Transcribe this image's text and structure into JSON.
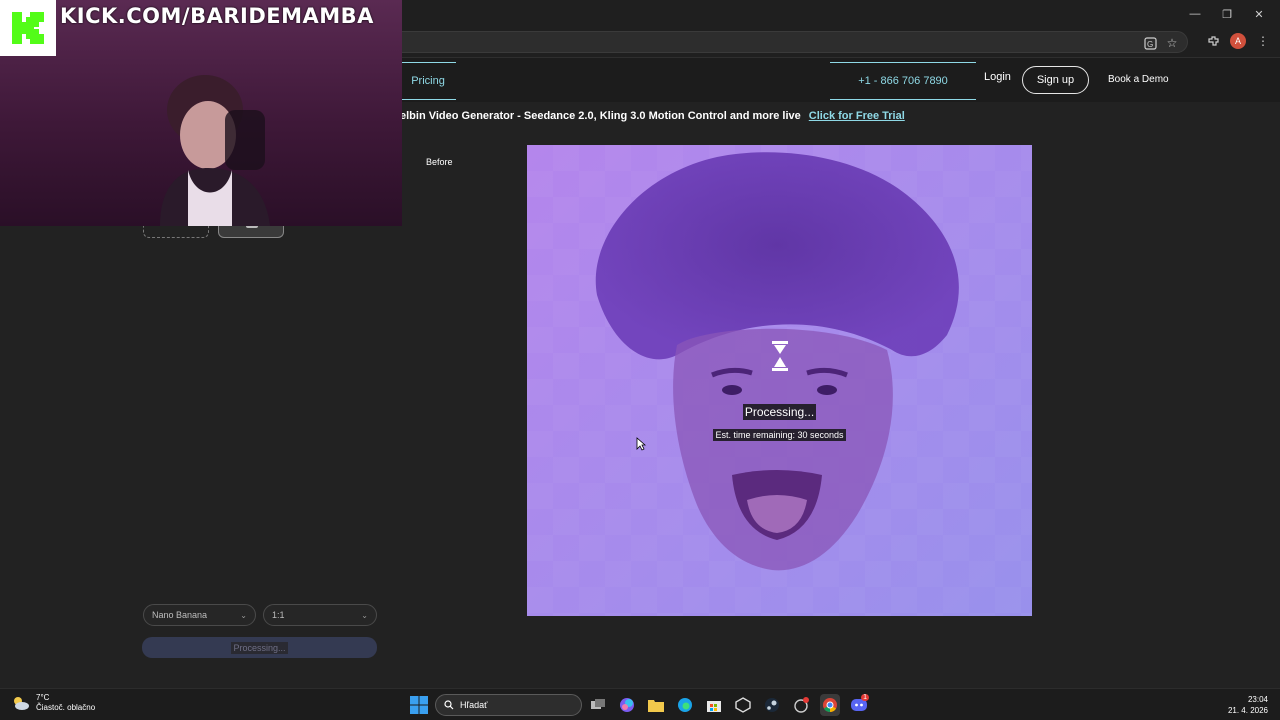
{
  "browser": {
    "window_controls": [
      "—",
      "❐",
      "✕"
    ],
    "profile_initial": "A"
  },
  "nav": {
    "pricing": "Pricing",
    "phone": "+1 - 866 706 7890",
    "login": "Login",
    "signup": "Sign up",
    "demo": "Book a Demo"
  },
  "banner": {
    "text": "elbin Video Generator - Seedance 2.0, Kling 3.0 Motion Control and more live",
    "link": "Click for Free Trial"
  },
  "editor": {
    "before_label": "Before",
    "model_select": "Nano Banana",
    "ratio_select": "1:1",
    "generate_button": "Processing..."
  },
  "preview": {
    "status": "Processing...",
    "eta": "Est. time remaining: 30 seconds"
  },
  "stream_overlay": {
    "url": "KICK.COM/BARIDEMAMBA"
  },
  "taskbar": {
    "weather_temp": "7°C",
    "weather_desc": "Čiastoč. oblačno",
    "search_placeholder": "Hľadať",
    "time": "23:04",
    "date": "21. 4. 2026",
    "discord_badge": "1"
  },
  "colors": {
    "accent_cyan": "#8fd9e6",
    "kick_green": "#53fc18",
    "preview_purple": "#a88ae6"
  }
}
